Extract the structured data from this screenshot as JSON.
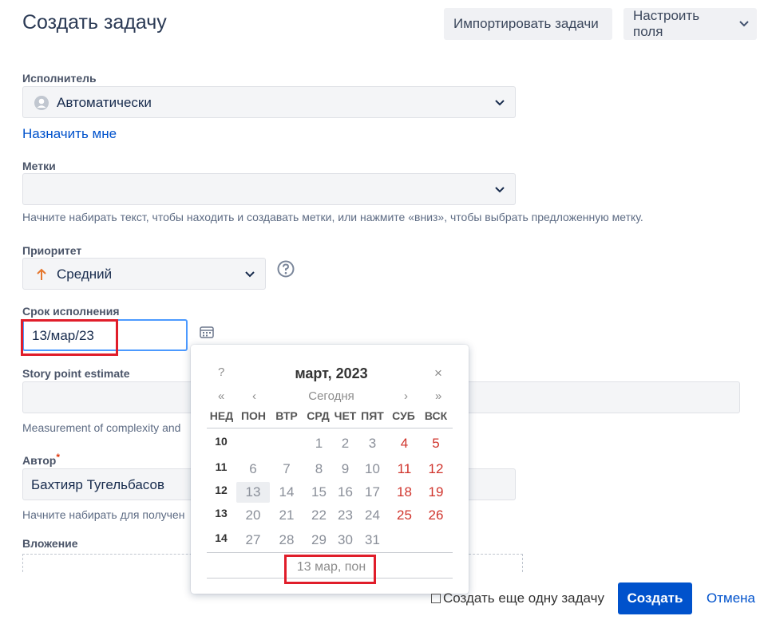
{
  "header": {
    "title": "Создать задачу",
    "import_label": "Импортировать задачи",
    "configure_label": "Настроить поля"
  },
  "assignee": {
    "label": "Исполнитель",
    "value": "Автоматически",
    "assign_me": "Назначить мне"
  },
  "labels_field": {
    "label": "Метки",
    "value": "",
    "help": "Начните набирать текст, чтобы находить и создавать метки, или нажмите «вниз», чтобы выбрать предложенную метку."
  },
  "priority": {
    "label": "Приоритет",
    "value": "Средний"
  },
  "due_date": {
    "label": "Срок исполнения",
    "value": "13/мар/23"
  },
  "story_points": {
    "label": "Story point estimate",
    "value": "",
    "help": "Measurement of complexity and"
  },
  "author": {
    "label": "Автор",
    "value": "Бахтияр Тугельбасов",
    "help": "Начните набирать для получен"
  },
  "attachment": {
    "label": "Вложение"
  },
  "calendar": {
    "help_symbol": "?",
    "month_title": "март, 2023",
    "close_symbol": "×",
    "prev_year": "«",
    "prev_month": "‹",
    "today_label": "Сегодня",
    "next_month": "›",
    "next_year": "»",
    "weekdays": [
      "НЕД",
      "ПОН",
      "ВТР",
      "СРД",
      "ЧЕТ",
      "ПЯТ",
      "СУБ",
      "ВСК"
    ],
    "weeks": [
      {
        "num": "10",
        "days": [
          "",
          "",
          "1",
          "2",
          "3",
          "4",
          "5"
        ]
      },
      {
        "num": "11",
        "days": [
          "6",
          "7",
          "8",
          "9",
          "10",
          "11",
          "12"
        ]
      },
      {
        "num": "12",
        "days": [
          "13",
          "14",
          "15",
          "16",
          "17",
          "18",
          "19"
        ]
      },
      {
        "num": "13",
        "days": [
          "20",
          "21",
          "22",
          "23",
          "24",
          "25",
          "26"
        ]
      },
      {
        "num": "14",
        "days": [
          "27",
          "28",
          "29",
          "30",
          "31",
          "",
          ""
        ]
      }
    ],
    "selected_display": "13 мар, пон"
  },
  "footer": {
    "create_another": "Создать еще одну задачу",
    "create_label": "Создать",
    "cancel_label": "Отмена"
  },
  "colors": {
    "primary": "#0052cc",
    "weekend": "#d0342c",
    "highlight_box": "#e01d2a",
    "priority_arrow": "#e5772e"
  }
}
